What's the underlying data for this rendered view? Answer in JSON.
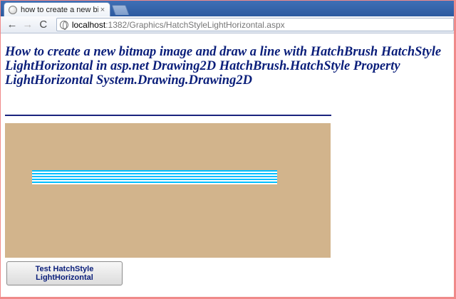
{
  "browser": {
    "tab": {
      "title": "how to create a new bitmap",
      "favicon": "globe-icon",
      "close_glyph": "×"
    },
    "nav": {
      "back_glyph": "←",
      "forward_glyph": "→",
      "reload_glyph": "C"
    },
    "address": {
      "host": "localhost",
      "path": ":1382/Graphics/HatchStyleLightHorizontal.aspx"
    }
  },
  "page": {
    "heading": "How to create a new bitmap image and draw a line with HatchBrush HatchStyle LightHorizontal in asp.net Drawing2D HatchBrush.HatchStyle Property LightHorizontal System.Drawing.Drawing2D",
    "button_label": "Test HatchStyle LightHorizontal"
  },
  "colors": {
    "heading": "#0a1e7a",
    "canvas_background": "#d2b48c",
    "hatch_fore": "#00bfff",
    "hatch_back": "#ffffff"
  }
}
